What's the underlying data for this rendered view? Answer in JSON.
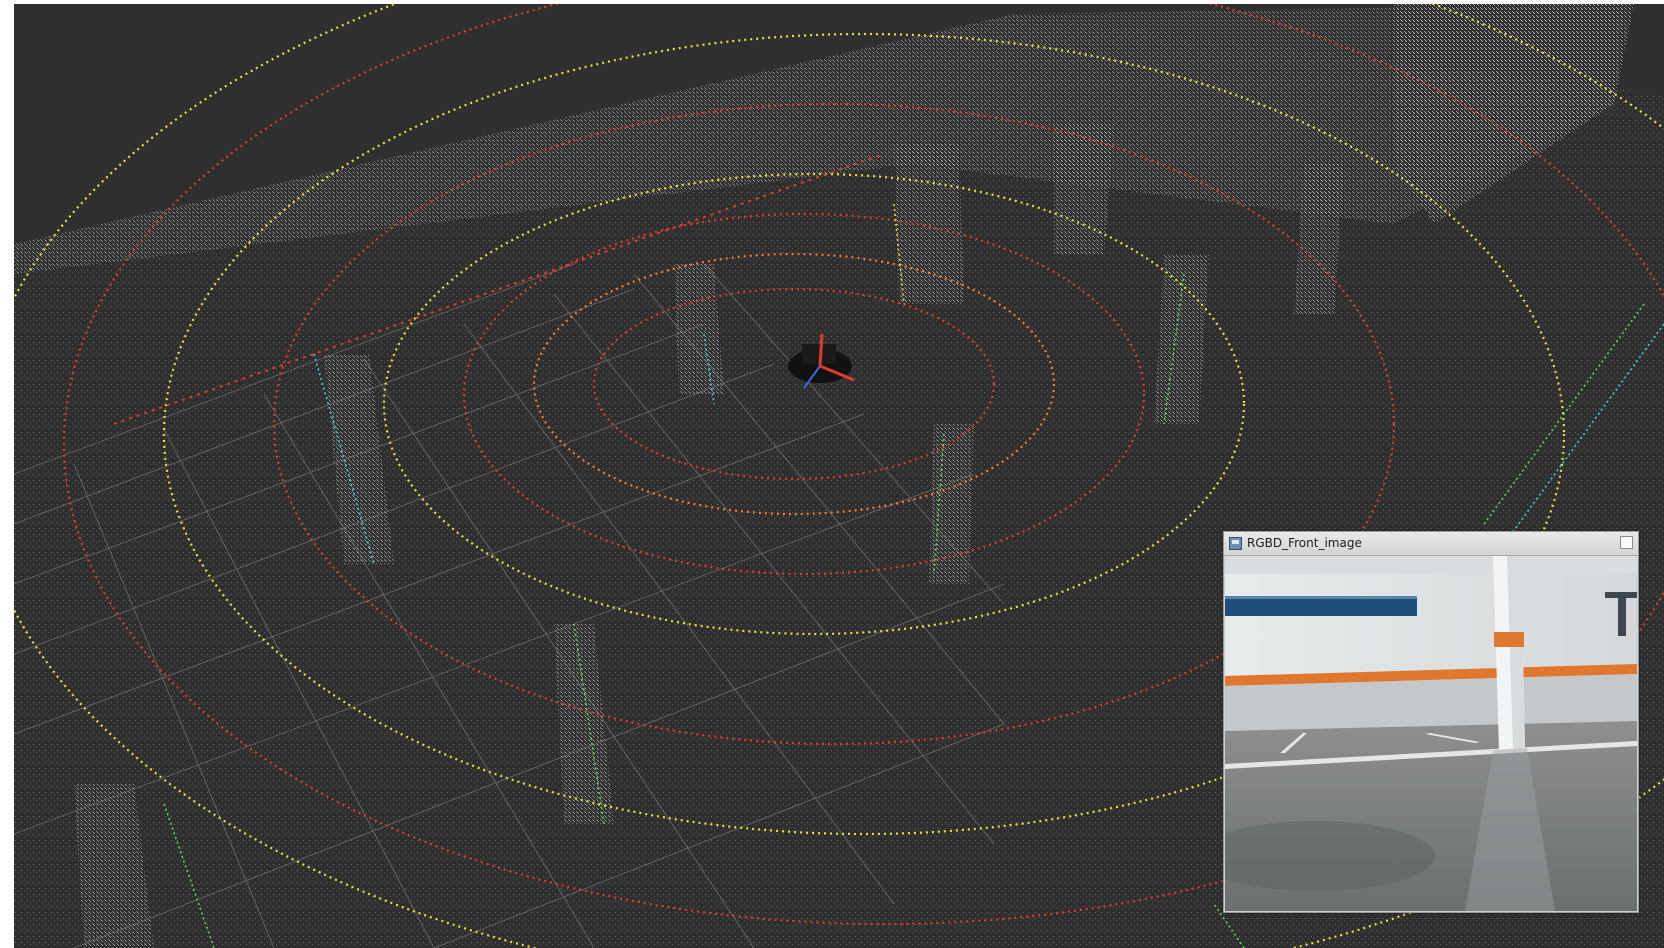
{
  "camera_window": {
    "title": "RGBD_Front_image",
    "icon": "image-window-icon",
    "maximize_icon": "maximize-icon"
  },
  "viewport": {
    "background": "#2f2f2f",
    "grid_color": "#8a8a8a",
    "point_cloud_color": "#c8c8c8",
    "scan_colors": [
      "#e03a2a",
      "#ff7a2a",
      "#e8e23a",
      "#3ad4d8",
      "#5ad85a"
    ]
  }
}
